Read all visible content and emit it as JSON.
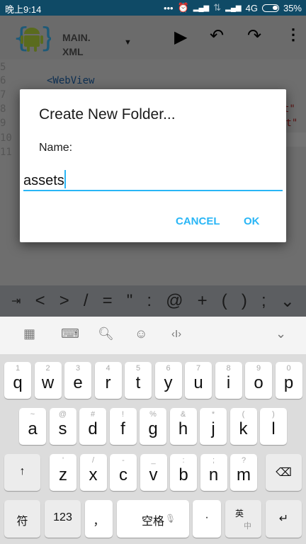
{
  "status_bar": {
    "time": "晚上9:14",
    "network": "4G",
    "battery": "35%",
    "icons": [
      "more-dots-icon",
      "alarm-icon",
      "signal-icon",
      "data-arrows-icon",
      "signal-icon",
      "battery-icon"
    ]
  },
  "toolbar": {
    "file_name_line1": "MAIN.",
    "file_name_line2": "XML",
    "icons": [
      "app-logo",
      "dropdown-icon",
      "run-icon",
      "undo-icon",
      "redo-icon",
      "overflow-menu-icon"
    ]
  },
  "editor": {
    "line_numbers": [
      "5",
      "6",
      "7",
      "8",
      "9",
      "10",
      "11"
    ],
    "line6": "<WebView",
    "line8_tail": "t\"",
    "line9_tail": "nt\""
  },
  "dialog": {
    "title": "Create New Folder...",
    "label": "Name:",
    "input_value": "assets",
    "cancel": "CANCEL",
    "ok": "OK",
    "accent": "#29b6f6"
  },
  "symbol_bar": [
    "⇥",
    "<",
    ">",
    "/",
    "=",
    "\"",
    ":",
    "@",
    "+",
    "(",
    ")",
    ";",
    "⌄"
  ],
  "keyboard_toolbar": {
    "icons": [
      "grid-icon",
      "keyboard-icon",
      "search-icon",
      "emoji-icon",
      "cursor-icon",
      "collapse-icon"
    ]
  },
  "keyboard": {
    "row1": [
      {
        "k": "q",
        "s": "1"
      },
      {
        "k": "w",
        "s": "2"
      },
      {
        "k": "e",
        "s": "3"
      },
      {
        "k": "r",
        "s": "4"
      },
      {
        "k": "t",
        "s": "5"
      },
      {
        "k": "y",
        "s": "6"
      },
      {
        "k": "u",
        "s": "7"
      },
      {
        "k": "i",
        "s": "8"
      },
      {
        "k": "o",
        "s": "9"
      },
      {
        "k": "p",
        "s": "0"
      }
    ],
    "row2": [
      {
        "k": "a",
        "s": "~"
      },
      {
        "k": "s",
        "s": "@"
      },
      {
        "k": "d",
        "s": "#"
      },
      {
        "k": "f",
        "s": "!"
      },
      {
        "k": "g",
        "s": "%"
      },
      {
        "k": "h",
        "s": "&"
      },
      {
        "k": "j",
        "s": "*"
      },
      {
        "k": "k",
        "s": "("
      },
      {
        "k": "l",
        "s": ")"
      }
    ],
    "row3": [
      {
        "k": "z",
        "s": "'"
      },
      {
        "k": "x",
        "s": "/"
      },
      {
        "k": "c",
        "s": "-"
      },
      {
        "k": "v",
        "s": "_"
      },
      {
        "k": "b",
        "s": ":"
      },
      {
        "k": "n",
        "s": ";"
      },
      {
        "k": "m",
        "s": "?"
      }
    ],
    "shift": "↑",
    "backspace": "⌫",
    "symbols": "符",
    "numbers": "123",
    "comma": "，",
    "space": "空格",
    "period": "·",
    "lang_top": "英",
    "lang_bottom": "中",
    "enter": "↵"
  }
}
